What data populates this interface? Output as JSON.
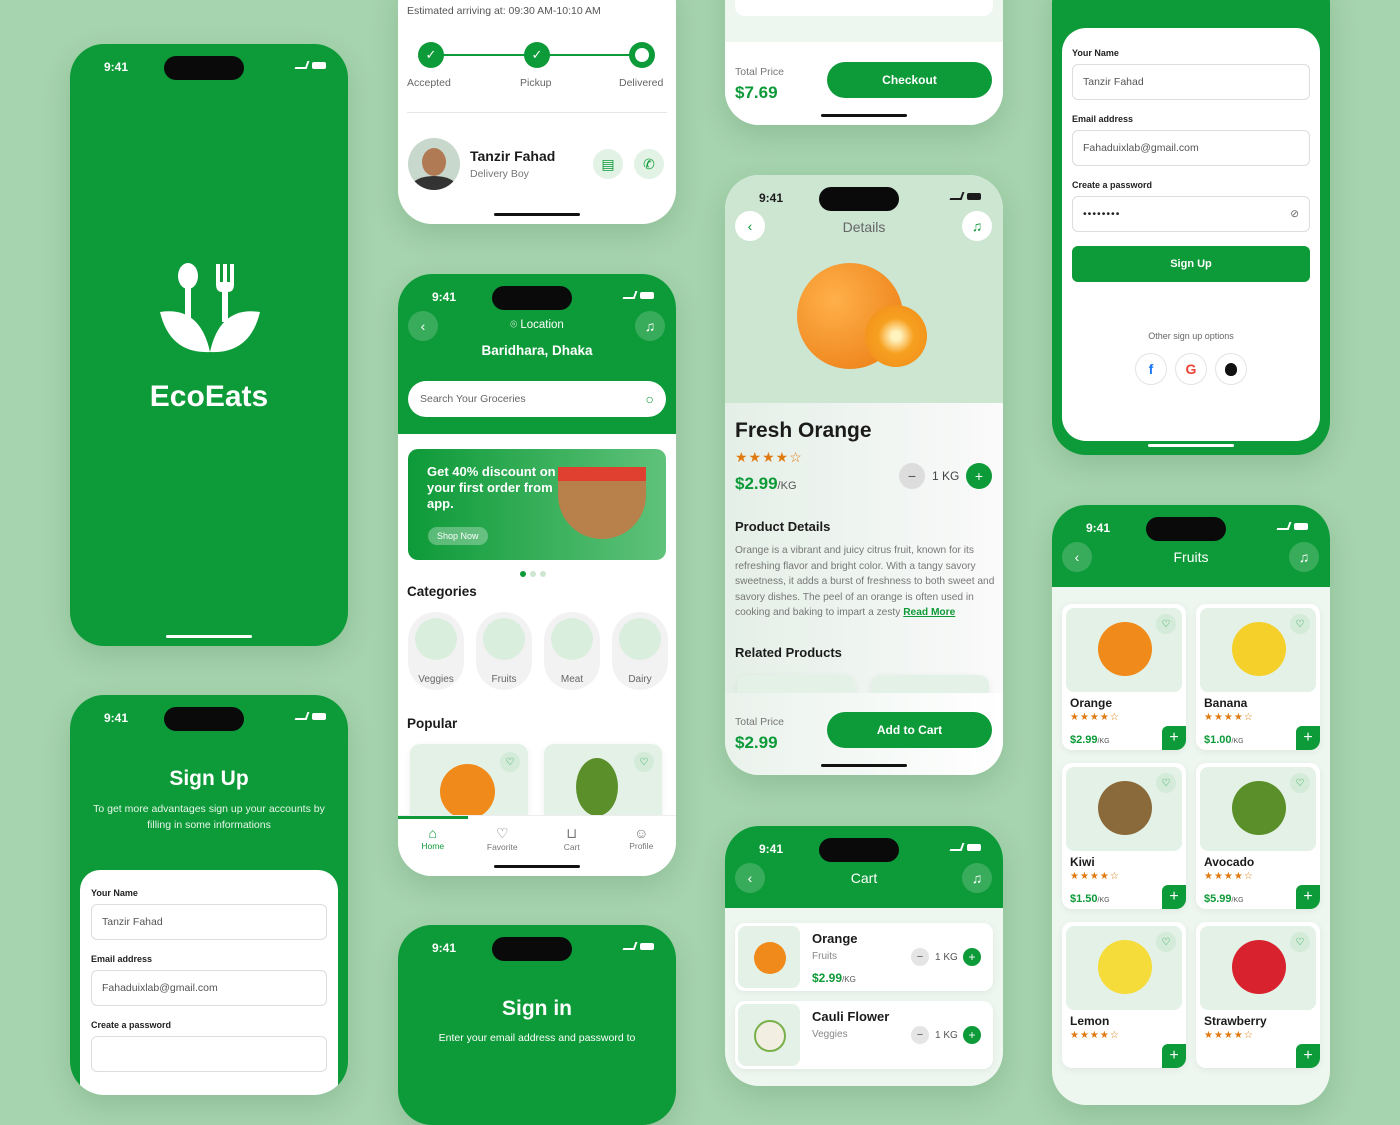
{
  "colors": {
    "brand": "#0d9a38",
    "background": "#a6d4ae",
    "star": "#e07a10"
  },
  "status_time": "9:41",
  "splash": {
    "app_name": "EcoEats",
    "logo_icon": "leaf-fork-spoon-icon"
  },
  "signup_left": {
    "title": "Sign Up",
    "subtitle": "To get more advantages sign up your accounts by filling in some informations",
    "name_label": "Your Name",
    "name_value": "Tanzir Fahad",
    "email_label": "Email address",
    "email_value": "Fahaduixlab@gmail.com",
    "password_label": "Create a password"
  },
  "tracking": {
    "estimate": "Estimated arriving at: 09:30 AM-10:10 AM",
    "steps": [
      "Accepted",
      "Pickup",
      "Delivered"
    ],
    "driver_name": "Tanzir Fahad",
    "driver_role": "Delivery Boy"
  },
  "home": {
    "location_label": "Location",
    "location": "Baridhara, Dhaka",
    "search_placeholder": "Search Your Groceries",
    "promo": "Get 40% discount on your first order from app.",
    "promo_button": "Shop Now",
    "categories_title": "Categories",
    "categories": [
      "Veggies",
      "Fruits",
      "Meat",
      "Dairy"
    ],
    "popular_title": "Popular",
    "nav": [
      "Home",
      "Favorite",
      "Cart",
      "Profile"
    ]
  },
  "signin": {
    "title": "Sign in",
    "subtitle": "Enter your email address and password to"
  },
  "checkout": {
    "total_label": "Total Price",
    "total": "$7.69",
    "button": "Checkout"
  },
  "details": {
    "title": "Details",
    "product": "Fresh Orange",
    "rating": 4,
    "price": "$2.99",
    "unit": "/KG",
    "qty": "1 KG",
    "section": "Product Details",
    "description": "Orange is a vibrant and juicy citrus fruit, known for its refreshing flavor and bright color. With a tangy savory sweetness, it adds a burst of freshness to both sweet and savory dishes. The peel of an orange is often used in cooking and baking to impart a zesty",
    "read_more": "Read More",
    "related": "Related Products",
    "total_label": "Total Price",
    "total": "$2.99",
    "button": "Add to Cart"
  },
  "cart": {
    "title": "Cart",
    "items": [
      {
        "name": "Orange",
        "category": "Fruits",
        "price": "$2.99",
        "unit": "/KG",
        "qty": "1 KG"
      },
      {
        "name": "Cauli Flower",
        "category": "Veggies",
        "qty": "1 KG"
      }
    ]
  },
  "signup_right": {
    "name_label": "Your Name",
    "name_value": "Tanzir Fahad",
    "email_label": "Email address",
    "email_value": "Fahaduixlab@gmail.com",
    "password_label": "Create a password",
    "password_value": "••••••••",
    "button": "Sign Up",
    "other": "Other sign up options",
    "socials": [
      "f",
      "G",
      ""
    ]
  },
  "fruits": {
    "title": "Fruits",
    "items": [
      {
        "name": "Orange",
        "price": "$2.99",
        "unit": "/KG",
        "color": "#f08a1a"
      },
      {
        "name": "Banana",
        "price": "$1.00",
        "unit": "/KG",
        "color": "#f5d02a"
      },
      {
        "name": "Kiwi",
        "price": "$1.50",
        "unit": "/KG",
        "color": "#8a6a3a"
      },
      {
        "name": "Avocado",
        "price": "$5.99",
        "unit": "/KG",
        "color": "#5b8f2a"
      },
      {
        "name": "Lemon",
        "price": "",
        "unit": "",
        "color": "#f5dc3a"
      },
      {
        "name": "Strawberry",
        "price": "",
        "unit": "",
        "color": "#d8232e"
      }
    ]
  }
}
